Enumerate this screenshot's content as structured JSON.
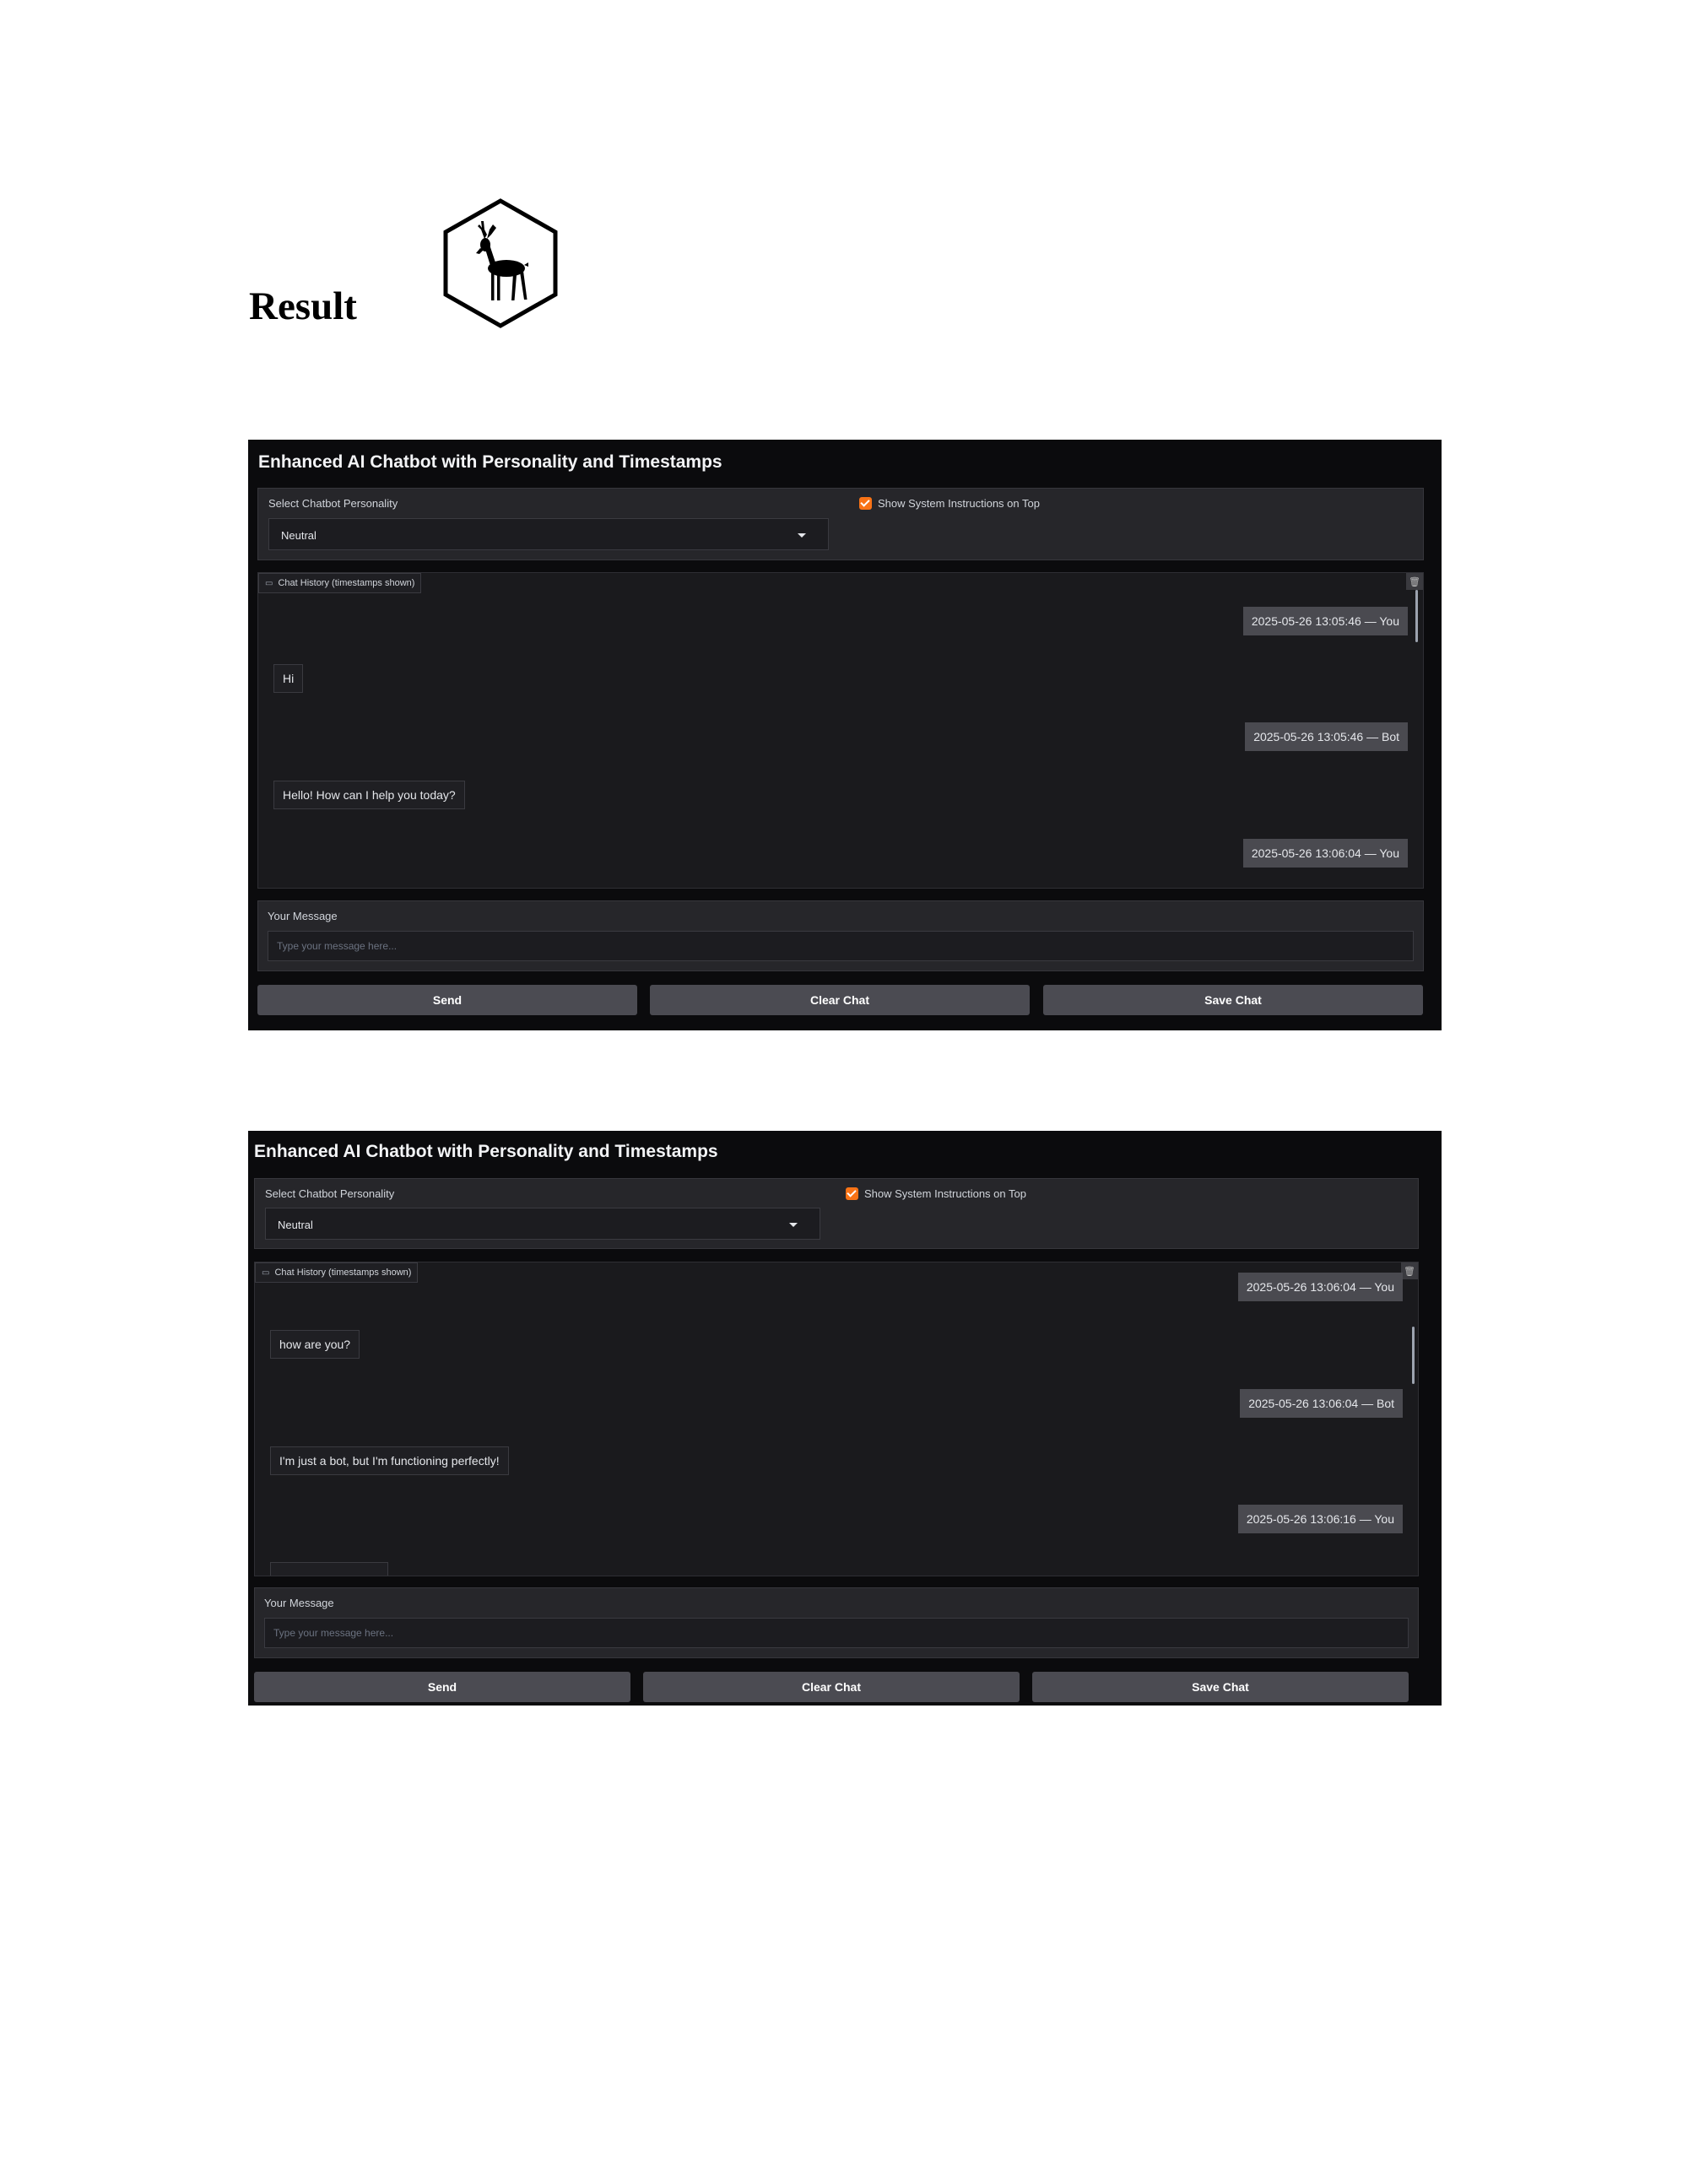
{
  "doc": {
    "heading": "Result"
  },
  "screens": [
    {
      "title": "Enhanced AI Chatbot with Personality and Timestamps",
      "personality_label": "Select Chatbot Personality",
      "personality_value": "Neutral",
      "checkbox_label": "Show System Instructions on Top",
      "checkbox_checked": true,
      "chat_label": "Chat History (timestamps shown)",
      "messages": [
        {
          "kind": "timestamp",
          "text": "2025-05-26 13:05:46 — You"
        },
        {
          "kind": "bubble",
          "text": "Hi"
        },
        {
          "kind": "timestamp",
          "text": "2025-05-26 13:05:46 — Bot"
        },
        {
          "kind": "bubble",
          "text": "Hello! How can I help you today?"
        },
        {
          "kind": "timestamp",
          "text": "2025-05-26 13:06:04 — You"
        }
      ],
      "message_label": "Your Message",
      "message_placeholder": "Type your message here...",
      "buttons": {
        "send": "Send",
        "clear": "Clear Chat",
        "save": "Save Chat"
      }
    },
    {
      "title": "Enhanced AI Chatbot with Personality and Timestamps",
      "personality_label": "Select Chatbot Personality",
      "personality_value": "Neutral",
      "checkbox_label": "Show System Instructions on Top",
      "checkbox_checked": true,
      "chat_label": "Chat History (timestamps shown)",
      "messages": [
        {
          "kind": "timestamp",
          "text": "2025-05-26 13:06:04 — You"
        },
        {
          "kind": "bubble",
          "text": "how are you?"
        },
        {
          "kind": "timestamp",
          "text": "2025-05-26 13:06:04 — Bot"
        },
        {
          "kind": "bubble",
          "text": "I'm just a bot, but I'm functioning perfectly!"
        },
        {
          "kind": "timestamp",
          "text": "2025-05-26 13:06:16 — You"
        },
        {
          "kind": "bubble",
          "text": ""
        }
      ],
      "message_label": "Your Message",
      "message_placeholder": "Type your message here...",
      "buttons": {
        "send": "Send",
        "clear": "Clear Chat",
        "save": "Save Chat"
      }
    }
  ],
  "colors": {
    "accent": "#f97316",
    "app_bg": "#0b0b0d",
    "panel_bg": "#26262a",
    "button_bg": "#4b4b52"
  }
}
